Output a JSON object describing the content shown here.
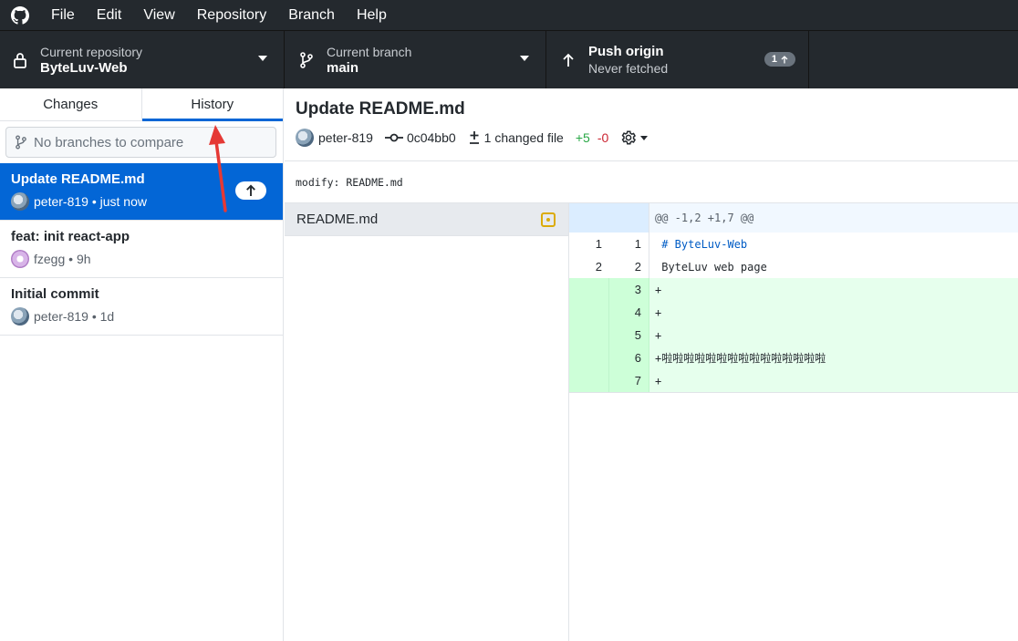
{
  "menu": {
    "items": [
      "File",
      "Edit",
      "View",
      "Repository",
      "Branch",
      "Help"
    ]
  },
  "toolbar": {
    "repository": {
      "label": "Current repository",
      "value": "ByteLuv-Web"
    },
    "branch": {
      "label": "Current branch",
      "value": "main"
    },
    "push": {
      "label": "Push origin",
      "sub": "Never fetched",
      "badge": "1"
    }
  },
  "sidebar": {
    "tabs": [
      "Changes",
      "History"
    ],
    "active_tab": "History",
    "compare_placeholder": "No branches to compare",
    "commits": [
      {
        "title": "Update README.md",
        "author": "peter-819",
        "time": "just now",
        "selected": true,
        "unpushed": true
      },
      {
        "title": "feat: init react-app",
        "author": "fzegg",
        "time": "9h",
        "selected": false
      },
      {
        "title": "Initial commit",
        "author": "peter-819",
        "time": "1d",
        "selected": false
      }
    ]
  },
  "commit_detail": {
    "title": "Update README.md",
    "author": "peter-819",
    "sha": "0c04bb0",
    "changed_files": "1 changed file",
    "additions": "+5",
    "deletions": "-0",
    "description": "modify: README.md"
  },
  "files": [
    {
      "name": "README.md",
      "status": "modified"
    }
  ],
  "diff": {
    "hunk": "@@ -1,2 +1,7 @@",
    "lines": [
      {
        "old": "1",
        "new": "1",
        "text": " # ByteLuv-Web",
        "type": "context"
      },
      {
        "old": "2",
        "new": "2",
        "text": " ByteLuv web page",
        "type": "context"
      },
      {
        "old": "",
        "new": "3",
        "text": "+",
        "type": "added"
      },
      {
        "old": "",
        "new": "4",
        "text": "+",
        "type": "added"
      },
      {
        "old": "",
        "new": "5",
        "text": "+",
        "type": "added"
      },
      {
        "old": "",
        "new": "6",
        "text": "+啦啦啦啦啦啦啦啦啦啦啦啦啦啦啦",
        "type": "added"
      },
      {
        "old": "",
        "new": "7",
        "text": "+",
        "type": "added"
      }
    ]
  },
  "colors": {
    "toolbar_bg": "#24292e",
    "accent": "#0366d6",
    "added_bg": "#e6ffed",
    "annotation_arrow": "#e53935"
  }
}
